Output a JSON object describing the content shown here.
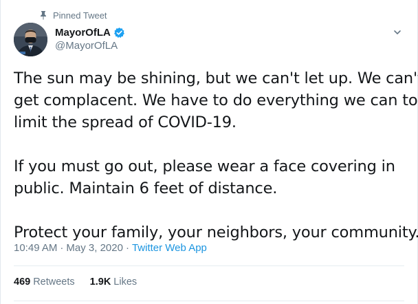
{
  "pinned": {
    "label": "Pinned Tweet",
    "icon": "pin-icon"
  },
  "author": {
    "display_name": "MayorOfLA",
    "handle": "@MayorOfLA",
    "verified": true,
    "verified_color": "#1da1f2"
  },
  "tweet": {
    "paragraphs": [
      [
        "The sun may be shining, but we can't let up. We can't",
        "get complacent. We have to do everything we can to",
        "limit the spread of COVID-19."
      ],
      [
        "If you must go out, please wear a face covering in",
        "public. Maintain 6 feet of distance."
      ],
      [
        "Protect your family, your neighbors, your community."
      ]
    ]
  },
  "meta": {
    "time": "10:49 AM",
    "separator": "·",
    "date": "May 3, 2020",
    "source": "Twitter Web App"
  },
  "stats": {
    "retweets_count": "469",
    "retweets_label": "Retweets",
    "likes_count": "1.9K",
    "likes_label": "Likes"
  },
  "colors": {
    "link": "#1b95e0",
    "secondary_text": "#657786",
    "primary_text": "#14171a",
    "border": "#e6ecf0"
  }
}
